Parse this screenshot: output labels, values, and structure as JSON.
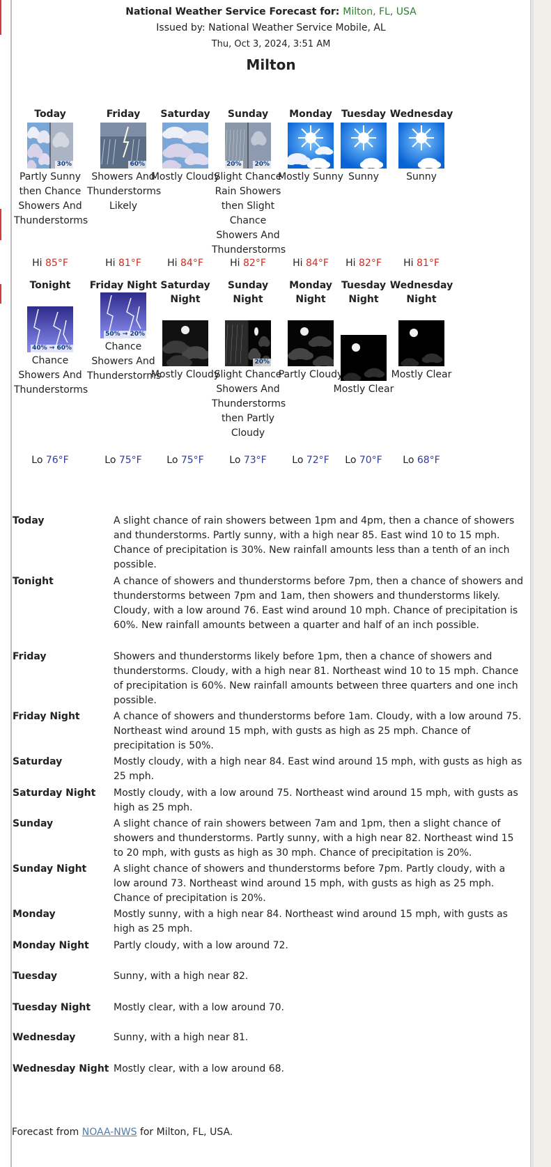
{
  "header": {
    "title_prefix": "National Weather Service Forecast for:",
    "location": "Milton, FL, USA",
    "issued_by": "Issued by: National Weather Service Mobile, AL",
    "issued_time": "Thu, Oct 3, 2024, 3:51 AM",
    "city": "Milton"
  },
  "day_periods": [
    {
      "name": "Today",
      "icon": "sun-cloud-storm-icon",
      "pop": "30%",
      "condition": "Partly Sunny then Chance Showers And Thunderstorms",
      "temp_prefix": "Hi",
      "temp": "85°F"
    },
    {
      "name": "Friday",
      "icon": "thunderstorm-icon",
      "pop": "60%",
      "condition": "Showers And Thunderstorms Likely",
      "temp_prefix": "Hi",
      "temp": "81°F"
    },
    {
      "name": "Saturday",
      "icon": "cloudy-icon",
      "pop": "",
      "condition": "Mostly Cloudy",
      "temp_prefix": "Hi",
      "temp": "84°F"
    },
    {
      "name": "Sunday",
      "icon": "rain-showers-icon",
      "pop": "20%",
      "pop2": "20%",
      "condition": "Slight Chance Rain Showers then Slight Chance Showers And Thunderstorms",
      "temp_prefix": "Hi",
      "temp": "82°F"
    },
    {
      "name": "Monday",
      "icon": "mostly-sunny-icon",
      "pop": "",
      "condition": "Mostly Sunny",
      "temp_prefix": "Hi",
      "temp": "84°F"
    },
    {
      "name": "Tuesday",
      "icon": "sunny-icon",
      "pop": "",
      "condition": "Sunny",
      "temp_prefix": "Hi",
      "temp": "82°F"
    },
    {
      "name": "Wednesday",
      "icon": "sunny-icon",
      "pop": "",
      "condition": "Sunny",
      "temp_prefix": "Hi",
      "temp": "81°F"
    }
  ],
  "night_periods": [
    {
      "name": "Tonight",
      "icon": "night-thunderstorm-icon",
      "pop": "40% → 60%",
      "condition": "Chance Showers And Thunderstorms",
      "temp_prefix": "Lo",
      "temp": "76°F"
    },
    {
      "name": "Friday Night",
      "icon": "night-thunderstorm-icon",
      "pop": "50% → 20%",
      "condition": "Chance Showers And Thunderstorms",
      "temp_prefix": "Lo",
      "temp": "75°F"
    },
    {
      "name": "Saturday Night",
      "icon": "night-cloudy-icon",
      "pop": "",
      "condition": "Mostly Cloudy",
      "temp_prefix": "Lo",
      "temp": "75°F"
    },
    {
      "name": "Sunday Night",
      "icon": "night-storm-partly-cloudy-icon",
      "pop": "20%",
      "condition": "Slight Chance Showers And Thunderstorms then Partly Cloudy",
      "temp_prefix": "Lo",
      "temp": "73°F"
    },
    {
      "name": "Monday Night",
      "icon": "night-partly-cloudy-icon",
      "pop": "",
      "condition": "Partly Cloudy",
      "temp_prefix": "Lo",
      "temp": "72°F"
    },
    {
      "name": "Tuesday Night",
      "icon": "night-mostly-clear-icon",
      "pop": "",
      "condition": "Mostly Clear",
      "temp_prefix": "Lo",
      "temp": "70°F"
    },
    {
      "name": "Wednesday Night",
      "icon": "night-mostly-clear-icon",
      "pop": "",
      "condition": "Mostly Clear",
      "temp_prefix": "Lo",
      "temp": "68°F"
    }
  ],
  "details": [
    {
      "name": "Today",
      "text": "A slight chance of rain showers between 1pm and 4pm, then a chance of showers and thunderstorms. Partly sunny, with a high near 85. East wind 10 to 15 mph. Chance of precipitation is 30%. New rainfall amounts less than a tenth of an inch possible."
    },
    {
      "name": "Tonight",
      "text": "A chance of showers and thunderstorms before 7pm, then a chance of showers and thunderstorms between 7pm and 1am, then showers and thunderstorms likely. Cloudy, with a low around 76. East wind around 10 mph. Chance of precipitation is 60%. New rainfall amounts between a quarter and half of an inch possible."
    },
    {
      "name": "Friday",
      "text": "Showers and thunderstorms likely before 1pm, then a chance of showers and thunderstorms. Cloudy, with a high near 81. Northeast wind 10 to 15 mph. Chance of precipitation is 60%. New rainfall amounts between three quarters and one inch possible."
    },
    {
      "name": "Friday Night",
      "text": "A chance of showers and thunderstorms before 1am. Cloudy, with a low around 75. Northeast wind around 15 mph, with gusts as high as 25 mph. Chance of precipitation is 50%."
    },
    {
      "name": "Saturday",
      "text": "Mostly cloudy, with a high near 84. East wind around 15 mph, with gusts as high as 25 mph."
    },
    {
      "name": "Saturday Night",
      "text": "Mostly cloudy, with a low around 75. Northeast wind around 15 mph, with gusts as high as 25 mph."
    },
    {
      "name": "Sunday",
      "text": "A slight chance of rain showers between 7am and 1pm, then a slight chance of showers and thunderstorms. Partly sunny, with a high near 82. Northeast wind 15 to 20 mph, with gusts as high as 30 mph. Chance of precipitation is 20%."
    },
    {
      "name": "Sunday Night",
      "text": "A slight chance of showers and thunderstorms before 7pm. Partly cloudy, with a low around 73. Northeast wind around 15 mph, with gusts as high as 25 mph. Chance of precipitation is 20%."
    },
    {
      "name": "Monday",
      "text": "Mostly sunny, with a high near 84. Northeast wind around 15 mph, with gusts as high as 25 mph."
    },
    {
      "name": "Monday Night",
      "text": "Partly cloudy, with a low around 72."
    },
    {
      "name": "Tuesday",
      "text": "Sunny, with a high near 82."
    },
    {
      "name": "Tuesday Night",
      "text": "Mostly clear, with a low around 70."
    },
    {
      "name": "Wednesday",
      "text": "Sunny, with a high near 81."
    },
    {
      "name": "Wednesday Night",
      "text": "Mostly clear, with a low around 68."
    }
  ],
  "footer": {
    "prefix": "Forecast from",
    "link": "NOAA-NWS",
    "suffix": "for Milton, FL, USA."
  },
  "colors": {
    "high": "#cc2e23",
    "low": "#2f3c9e",
    "location": "#2e7d32",
    "link": "#4f7da9"
  }
}
